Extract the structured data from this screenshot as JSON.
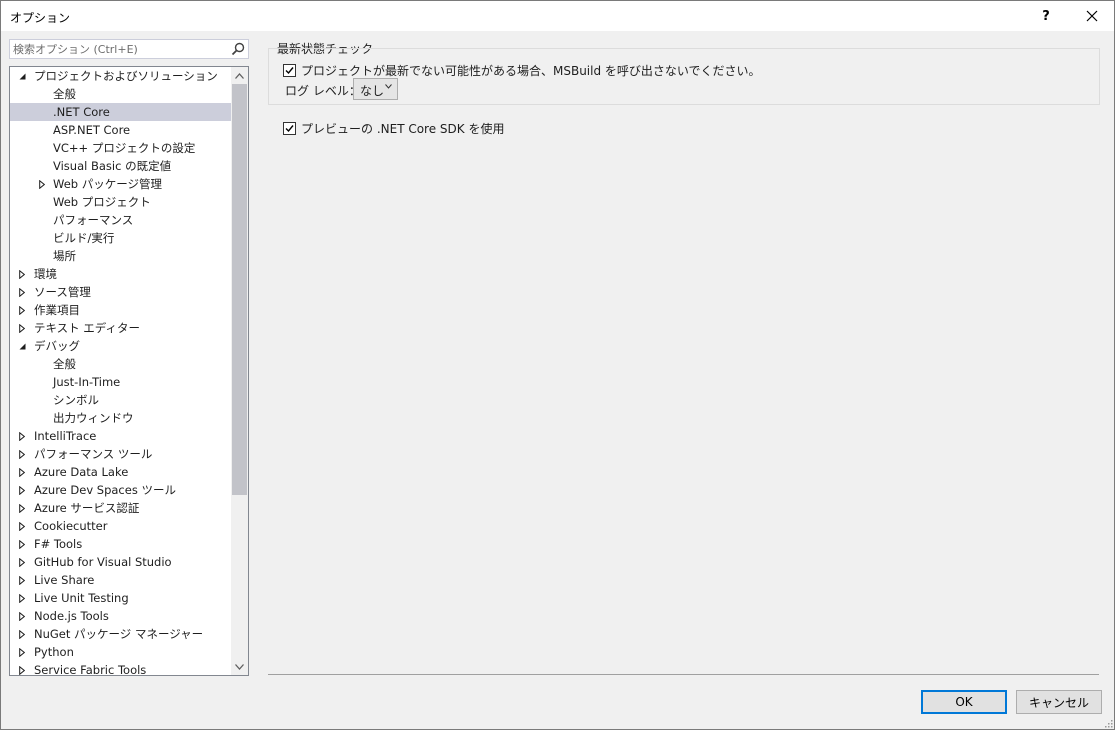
{
  "window": {
    "title": "オプション",
    "help_label": "?",
    "close_label": "✕"
  },
  "search": {
    "placeholder": "検索オプション (Ctrl+E)"
  },
  "tree": {
    "items": [
      {
        "label": "プロジェクトおよびソリューション",
        "level": 0,
        "expander": "expanded"
      },
      {
        "label": "全般",
        "level": 1,
        "expander": "none"
      },
      {
        "label": ".NET Core",
        "level": 1,
        "expander": "none",
        "selected": true
      },
      {
        "label": "ASP.NET Core",
        "level": 1,
        "expander": "none"
      },
      {
        "label": "VC++ プロジェクトの設定",
        "level": 1,
        "expander": "none"
      },
      {
        "label": "Visual Basic の既定値",
        "level": 1,
        "expander": "none"
      },
      {
        "label": "Web パッケージ管理",
        "level": 1,
        "expander": "collapsed"
      },
      {
        "label": "Web プロジェクト",
        "level": 1,
        "expander": "none"
      },
      {
        "label": "パフォーマンス",
        "level": 1,
        "expander": "none"
      },
      {
        "label": "ビルド/実行",
        "level": 1,
        "expander": "none"
      },
      {
        "label": "場所",
        "level": 1,
        "expander": "none"
      },
      {
        "label": "環境",
        "level": 0,
        "expander": "collapsed"
      },
      {
        "label": "ソース管理",
        "level": 0,
        "expander": "collapsed"
      },
      {
        "label": "作業項目",
        "level": 0,
        "expander": "collapsed"
      },
      {
        "label": "テキスト エディター",
        "level": 0,
        "expander": "collapsed"
      },
      {
        "label": "デバッグ",
        "level": 0,
        "expander": "expanded"
      },
      {
        "label": "全般",
        "level": 1,
        "expander": "none"
      },
      {
        "label": "Just-In-Time",
        "level": 1,
        "expander": "none"
      },
      {
        "label": "シンボル",
        "level": 1,
        "expander": "none"
      },
      {
        "label": "出力ウィンドウ",
        "level": 1,
        "expander": "none"
      },
      {
        "label": "IntelliTrace",
        "level": 0,
        "expander": "collapsed"
      },
      {
        "label": "パフォーマンス ツール",
        "level": 0,
        "expander": "collapsed"
      },
      {
        "label": "Azure Data Lake",
        "level": 0,
        "expander": "collapsed"
      },
      {
        "label": "Azure Dev Spaces ツール",
        "level": 0,
        "expander": "collapsed"
      },
      {
        "label": "Azure サービス認証",
        "level": 0,
        "expander": "collapsed"
      },
      {
        "label": "Cookiecutter",
        "level": 0,
        "expander": "collapsed"
      },
      {
        "label": "F# Tools",
        "level": 0,
        "expander": "collapsed"
      },
      {
        "label": "GitHub for Visual Studio",
        "level": 0,
        "expander": "collapsed"
      },
      {
        "label": "Live Share",
        "level": 0,
        "expander": "collapsed"
      },
      {
        "label": "Live Unit Testing",
        "level": 0,
        "expander": "collapsed"
      },
      {
        "label": "Node.js Tools",
        "level": 0,
        "expander": "collapsed"
      },
      {
        "label": "NuGet パッケージ マネージャー",
        "level": 0,
        "expander": "collapsed"
      },
      {
        "label": "Python",
        "level": 0,
        "expander": "collapsed"
      },
      {
        "label": "Service Fabric Tools",
        "level": 0,
        "expander": "collapsed"
      }
    ]
  },
  "panel": {
    "group_title": "最新状態チェック",
    "msbuild_checkbox_label": "プロジェクトが最新でない可能性がある場合、MSBuild を呼び出さないでください。",
    "msbuild_checked": true,
    "log_level_label": "ログ レベル：",
    "log_level_value": "なし",
    "preview_sdk_label": "プレビューの .NET Core SDK を使用",
    "preview_sdk_checked": true
  },
  "buttons": {
    "ok": "OK",
    "cancel": "キャンセル"
  },
  "colors": {
    "selected_row": "#cccedb",
    "ok_border": "#0078d7"
  }
}
